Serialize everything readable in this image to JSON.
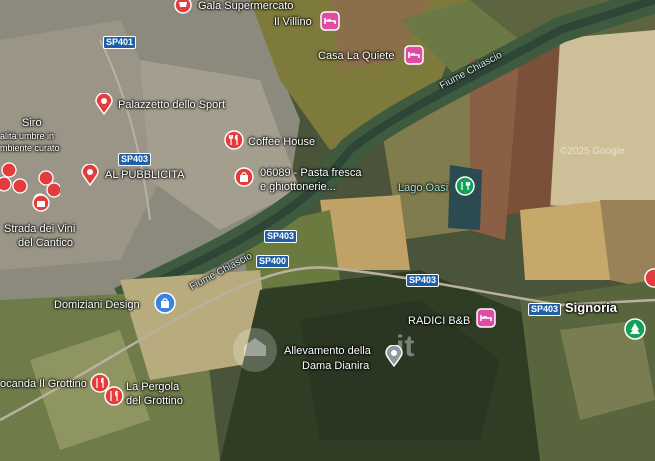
{
  "map": {
    "copyright": "©2025 Google",
    "watermark": "it",
    "colors": {
      "food": "#e23c3c",
      "hotel": "#e04ca3",
      "shop": "#e23c3c",
      "sport": "#e23c3c",
      "service": "#3b83e0",
      "park": "#15a05a",
      "poi": "#8d98a0"
    },
    "rivers": [
      {
        "label": "Fiume Chiascio"
      },
      {
        "label": "Fiume Chiascio"
      }
    ],
    "places": [
      {
        "label": "Signoria"
      }
    ],
    "water": [
      {
        "label": "Lago Oasi"
      }
    ],
    "roads": [
      {
        "label": "SP401"
      },
      {
        "label": "SP403"
      },
      {
        "label": "SP403"
      },
      {
        "label": "SP400"
      },
      {
        "label": "SP403"
      },
      {
        "label": "SP403"
      }
    ],
    "pois": [
      {
        "label": "Gala Supermercato",
        "icon": "shopping-cart-icon",
        "kind": "shop"
      },
      {
        "label": "Il Villino",
        "icon": "bed-icon",
        "kind": "hotel"
      },
      {
        "label": "Casa La Quiete",
        "icon": "bed-icon",
        "kind": "hotel"
      },
      {
        "label": "Palazzetto dello Sport",
        "icon": "location-pin-icon",
        "kind": "sport"
      },
      {
        "label": "Coffee House",
        "icon": "restaurant-icon",
        "kind": "food"
      },
      {
        "label": "AL PUBBLICITA",
        "icon": "location-pin-icon",
        "kind": "shop"
      },
      {
        "label": "06089 - Pasta fresca",
        "label2": "e ghiottonerie...",
        "icon": "shopping-bag-icon",
        "kind": "shop"
      },
      {
        "label": "Siro",
        "label2": "alità umbre in",
        "label3": "mbiente curato",
        "icon": "none",
        "kind": "food"
      },
      {
        "label": "Strada dei Vini",
        "label2": "del Cantico",
        "icon": "shopping-bag-icon",
        "kind": "shop"
      },
      {
        "label": "Domiziani Design",
        "icon": "shopping-bag-icon",
        "kind": "service"
      },
      {
        "label": "RADICI B&B",
        "icon": "bed-icon",
        "kind": "hotel"
      },
      {
        "label": "Allevamento della",
        "label2": "Dama Dianira",
        "icon": "location-pin-icon",
        "kind": "poi"
      },
      {
        "label": "ocanda Il Grottino",
        "icon": "restaurant-icon",
        "kind": "food"
      },
      {
        "label": "La Pergola",
        "label2": "del Grottino",
        "icon": "restaurant-icon",
        "kind": "food"
      },
      {
        "label": "",
        "icon": "tree-icon",
        "kind": "park"
      }
    ]
  }
}
